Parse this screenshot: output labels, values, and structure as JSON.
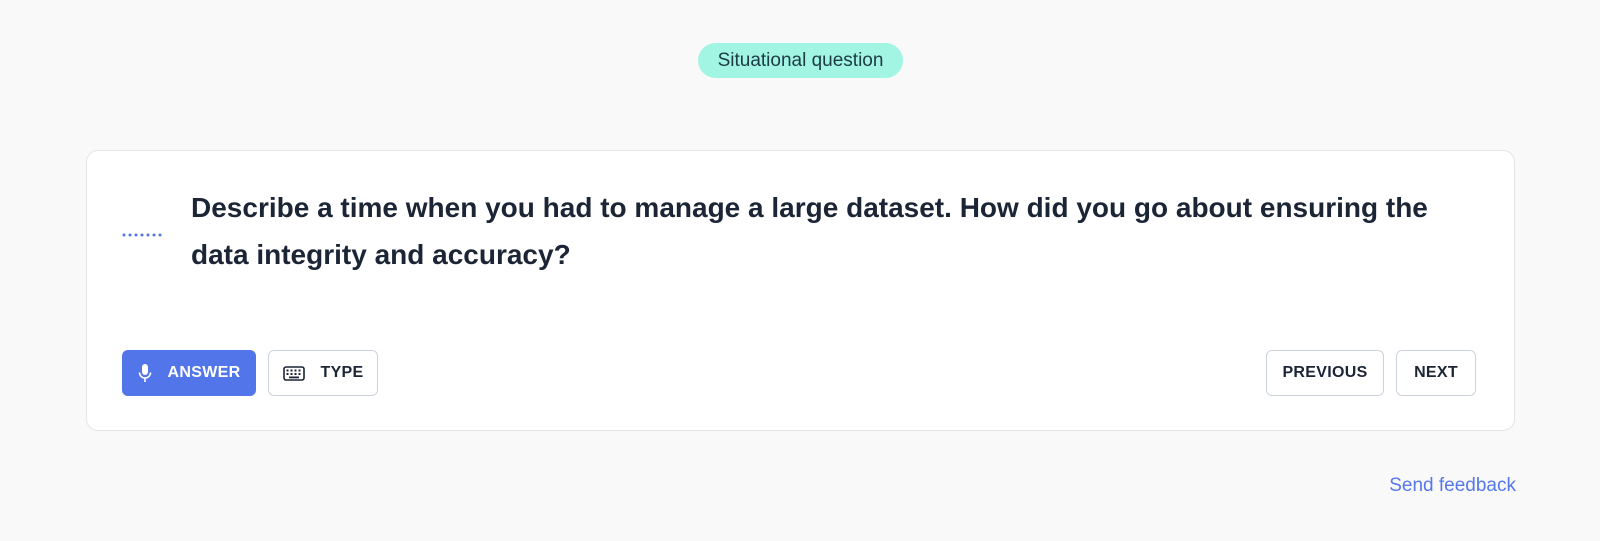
{
  "tag": {
    "label": "Situational question"
  },
  "question": {
    "text": "Describe a time when you had to manage a large dataset. How did you go about ensuring the data integrity and accuracy?"
  },
  "actions": {
    "answer_label": "ANSWER",
    "type_label": "TYPE",
    "previous_label": "PREVIOUS",
    "next_label": "NEXT"
  },
  "icons": {
    "audio_indicator": "audio-dots-icon",
    "answer": "microphone-icon",
    "type": "keyboard-icon"
  },
  "footer": {
    "feedback_label": "Send feedback"
  },
  "colors": {
    "accent": "#5275ea",
    "tag_background": "#a2f5e3",
    "link": "#5578ea",
    "text": "#1b2536",
    "page_background": "#f9f9fa"
  }
}
